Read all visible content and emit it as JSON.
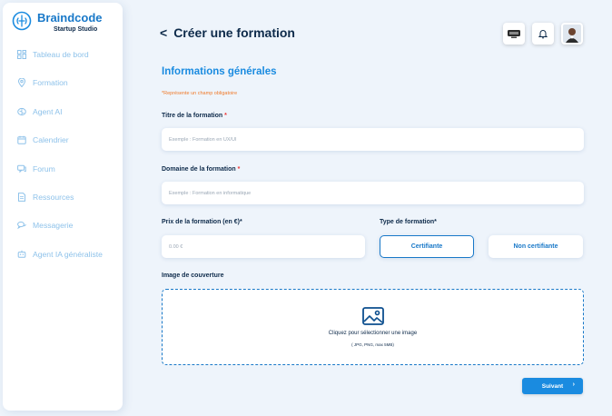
{
  "brand": {
    "name": "Braindcode",
    "subtitle": "Startup Studio"
  },
  "sidebar": {
    "items": [
      {
        "label": "Tableau de bord",
        "icon": "dashboard-icon"
      },
      {
        "label": "Formation",
        "icon": "location-pin-icon"
      },
      {
        "label": "Agent AI",
        "icon": "brain-icon"
      },
      {
        "label": "Calendrier",
        "icon": "calendar-icon"
      },
      {
        "label": "Forum",
        "icon": "forum-icon"
      },
      {
        "label": "Ressources",
        "icon": "document-icon"
      },
      {
        "label": "Messagerie",
        "icon": "chat-icon"
      },
      {
        "label": "Agent IA généraliste",
        "icon": "robot-icon"
      }
    ]
  },
  "header": {
    "back": "<",
    "title": "Créer une formation"
  },
  "form": {
    "section_title": "Informations générales",
    "required_note": "*Représente un champ obligatoire",
    "title_label": "Titre de la formation",
    "title_placeholder": "Exemple : Formation en UX/UI",
    "domain_label": "Domaine de la formation",
    "domain_placeholder": "Exemple : Formation en informatique",
    "price_label": "Prix de la formation (en €)*",
    "price_placeholder": "0.00 €",
    "type_label": "Type de formation*",
    "type_options": [
      "Certifiante",
      "Non certifiante"
    ],
    "cover_label": "Image de couverture",
    "cover_text": "Cliquez pour sélectionner une image",
    "cover_hint": "( JPG, PNG, max 5MB)",
    "star": "*",
    "next_label": "Suivant",
    "next_chevron": "›"
  },
  "colors": {
    "accent": "#1a8be0",
    "dark": "#0d2a4a",
    "required": "#f07a2a",
    "sidebar_text": "#8ec2ea"
  }
}
